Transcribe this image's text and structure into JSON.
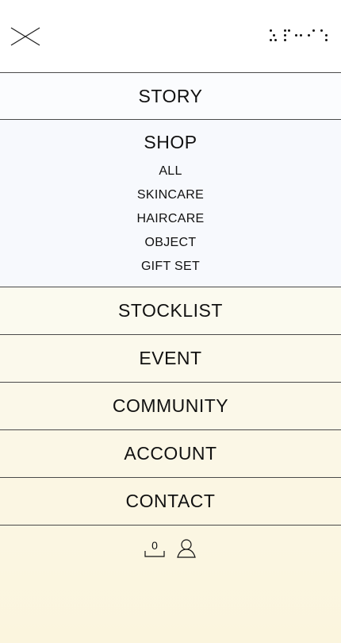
{
  "header": {
    "close_icon": "close-icon",
    "logo_icon": "braille-logo"
  },
  "menu": {
    "story": "STORY",
    "shop": "SHOP",
    "shop_submenu": [
      "ALL",
      "SKINCARE",
      "HAIRCARE",
      "OBJECT",
      "GIFT SET"
    ],
    "stocklist": "STOCKLIST",
    "event": "EVENT",
    "community": "COMMUNITY",
    "account": "ACCOUNT",
    "contact": "CONTACT"
  },
  "footer": {
    "cart_count": "0",
    "cart_icon": "cart-tray-icon",
    "user_icon": "user-icon"
  },
  "colors": {
    "divider": "#4a4a4a",
    "text": "#111111",
    "background_top": "#f7f8fc",
    "background_bottom": "#fbf5de"
  }
}
